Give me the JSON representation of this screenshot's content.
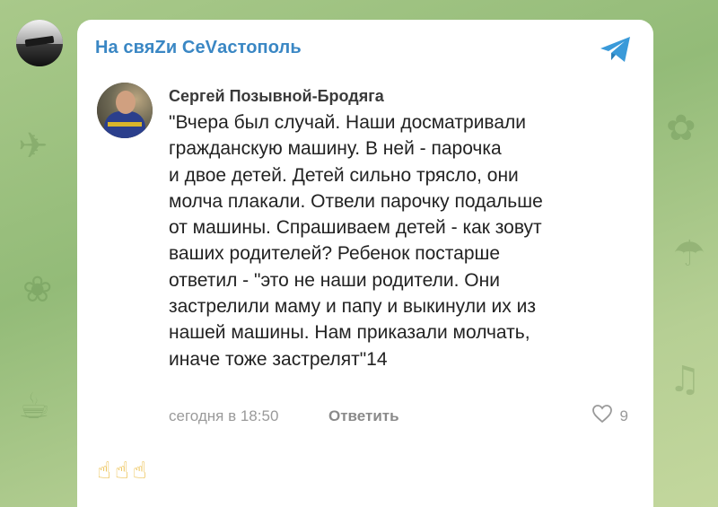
{
  "channel": {
    "name": "На свяZи CeVастополь",
    "share_icon": "telegram-share-icon"
  },
  "comment": {
    "author": "Сергей Позывной-Бродяга",
    "text": "\"Вчера был случай. Наши досматривали\nгражданскую машину. В ней - парочка\nи двое детей. Детей сильно трясло, они\nмолча плакали. Отвели парочку подальше\nот машины. Спрашиваем детей - как зовут\nваших родителей? Ребенок постарше\nответил - \"это не наши родители. Они\nзастрелили маму и папу и выкинули их из\nнашей машины. Нам приказали молчать,\nиначе тоже застрелят\"14",
    "time": "сегодня в 18:50",
    "reply_label": "Ответить",
    "likes": "9"
  },
  "reactions": {
    "emoji": "☝☝☝"
  },
  "colors": {
    "accent": "#3a87c4",
    "background": "#a9c98a"
  }
}
